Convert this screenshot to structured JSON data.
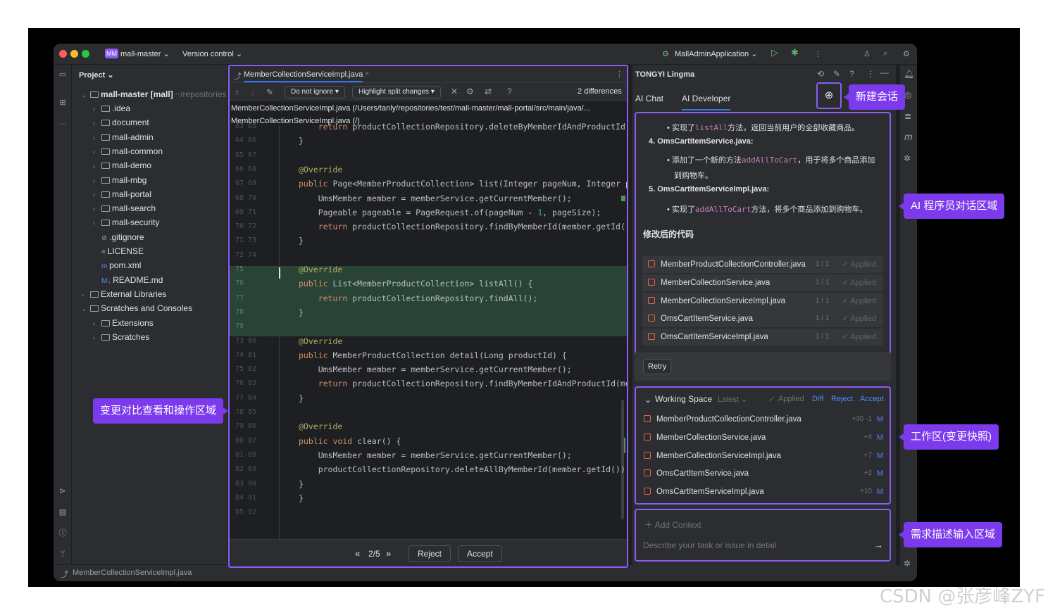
{
  "titlebar": {
    "project_badge": "MM",
    "project": "mall-master",
    "vcs": "Version control",
    "run_config": "MallAdminApplication"
  },
  "project_panel": {
    "title": "Project",
    "root": "mall-master [mall]",
    "root_path": "~/repositories",
    "items": [
      ".idea",
      "document",
      "mall-admin",
      "mall-common",
      "mall-demo",
      "mall-mbg",
      "mall-portal",
      "mall-search",
      "mall-security",
      ".gitignore",
      "LICENSE",
      "pom.xml",
      "README.md",
      "External Libraries",
      "Scratches and Consoles",
      "Extensions",
      "Scratches"
    ]
  },
  "diff": {
    "tab": "MemberCollectionServiceImpl.java",
    "ignore": "Do not ignore",
    "highlight": "Highlight split changes",
    "differences": "2 differences",
    "path1": "MemberCollectionServiceImpl.java (/Users/tanly/repositories/test/mall-master/mall-portal/src/main/java/...",
    "path2": "MemberCollectionServiceImpl.java (/)",
    "gutter": [
      "63 65",
      "64 66",
      "65 67",
      "66 68",
      "67 69",
      "68 70",
      "69 71",
      "70 72",
      "71 73",
      "72 74",
      "75",
      "76",
      "77",
      "78",
      "79",
      "73 80",
      "74 81",
      "75 82",
      "76 83",
      "77 84",
      "78 85",
      "79 86",
      "80 87",
      "81 88",
      "82 89",
      "83 90",
      "84 91",
      "85 92"
    ],
    "lines": [
      "    return productCollectionRepository.deleteByMemberIdAndProductId(mem",
      "}",
      "",
      "@Override",
      "public Page<MemberProductCollection> list(Integer pageNum, Integer page",
      "    UmsMember member = memberService.getCurrentMember();",
      "    Pageable pageable = PageRequest.of(pageNum - 1, pageSize);",
      "    return productCollectionRepository.findByMemberId(member.getId(), p",
      "}",
      "",
      "@Override",
      "public List<MemberProductCollection> listAll() {",
      "    return productCollectionRepository.findAll();",
      "}",
      "",
      "@Override",
      "public MemberProductCollection detail(Long productId) {",
      "    UmsMember member = memberService.getCurrentMember();",
      "    return productCollectionRepository.findByMemberIdAndProductId(membe",
      "}",
      "",
      "@Override",
      "public void clear() {",
      "    UmsMember member = memberService.getCurrentMember();",
      "    productCollectionRepository.deleteAllByMemberId(member.getId());",
      "}",
      "}",
      ""
    ],
    "pager": "2/5",
    "reject": "Reject",
    "accept": "Accept"
  },
  "assistant": {
    "title": "TONGYI Lingma",
    "tab_chat": "AI Chat",
    "tab_dev": "AI Developer",
    "bullet1_pre": "实现了",
    "bullet1_code": "listAll",
    "bullet1_post": "方法，返回当前用户的全部收藏商品。",
    "item4": "4.  OmsCartItemService.java:",
    "bullet2_pre": "添加了一个新的方法",
    "bullet2_code": "addAllToCart",
    "bullet2_post": "，用于将多个商品添加",
    "bullet2_cont": "到购物车。",
    "item5": "5.  OmsCartItemServiceImpl.java:",
    "bullet3_pre": "实现了",
    "bullet3_code": "addAllToCart",
    "bullet3_post": "方法，将多个商品添加到购物车。",
    "modified_heading": "修改后的代码",
    "files": [
      {
        "name": "MemberProductCollectionController.java",
        "count": "1 / 1",
        "status": "Applied"
      },
      {
        "name": "MemberCollectionService.java",
        "count": "1 / 1",
        "status": "Applied"
      },
      {
        "name": "MemberCollectionServiceImpl.java",
        "count": "1 / 1",
        "status": "Applied"
      },
      {
        "name": "OmsCartItemService.java",
        "count": "1 / 1",
        "status": "Applied"
      },
      {
        "name": "OmsCartItemServiceImpl.java",
        "count": "1 / 1",
        "status": "Applied"
      }
    ],
    "retry": "Retry",
    "ws_title": "Working Space",
    "ws_version": "Latest",
    "ws_applied": "Applied",
    "ws_diff": "Diff",
    "ws_reject": "Reject",
    "ws_accept": "Accept",
    "ws_files": [
      {
        "name": "MemberProductCollectionController.java",
        "delta": "+30 -1",
        "mark": "M"
      },
      {
        "name": "MemberCollectionService.java",
        "delta": "+4",
        "mark": "M"
      },
      {
        "name": "MemberCollectionServiceImpl.java",
        "delta": "+7",
        "mark": "M"
      },
      {
        "name": "OmsCartItemService.java",
        "delta": "+2",
        "mark": "M"
      },
      {
        "name": "OmsCartItemServiceImpl.java",
        "delta": "+10",
        "mark": "M"
      }
    ],
    "add_context": "Add Context",
    "placeholder": "Describe your task or issue in detail"
  },
  "status_file": "MemberCollectionServiceImpl.java",
  "callouts": {
    "new_session": "新建会话",
    "ai_area": "AI 程序员对话区域",
    "diff_area": "变更对比查看和操作区域",
    "workspace": "工作区(变更快照)",
    "input_area": "需求描述输入区域"
  },
  "watermark": "CSDN @张彦峰ZYF",
  "colors": {
    "accent": "#8b5cf6",
    "callout_bg": "#7c3aed",
    "added_bg": "#294436",
    "editor_bg": "#1e1f22",
    "panel_bg": "#2b2d30"
  }
}
